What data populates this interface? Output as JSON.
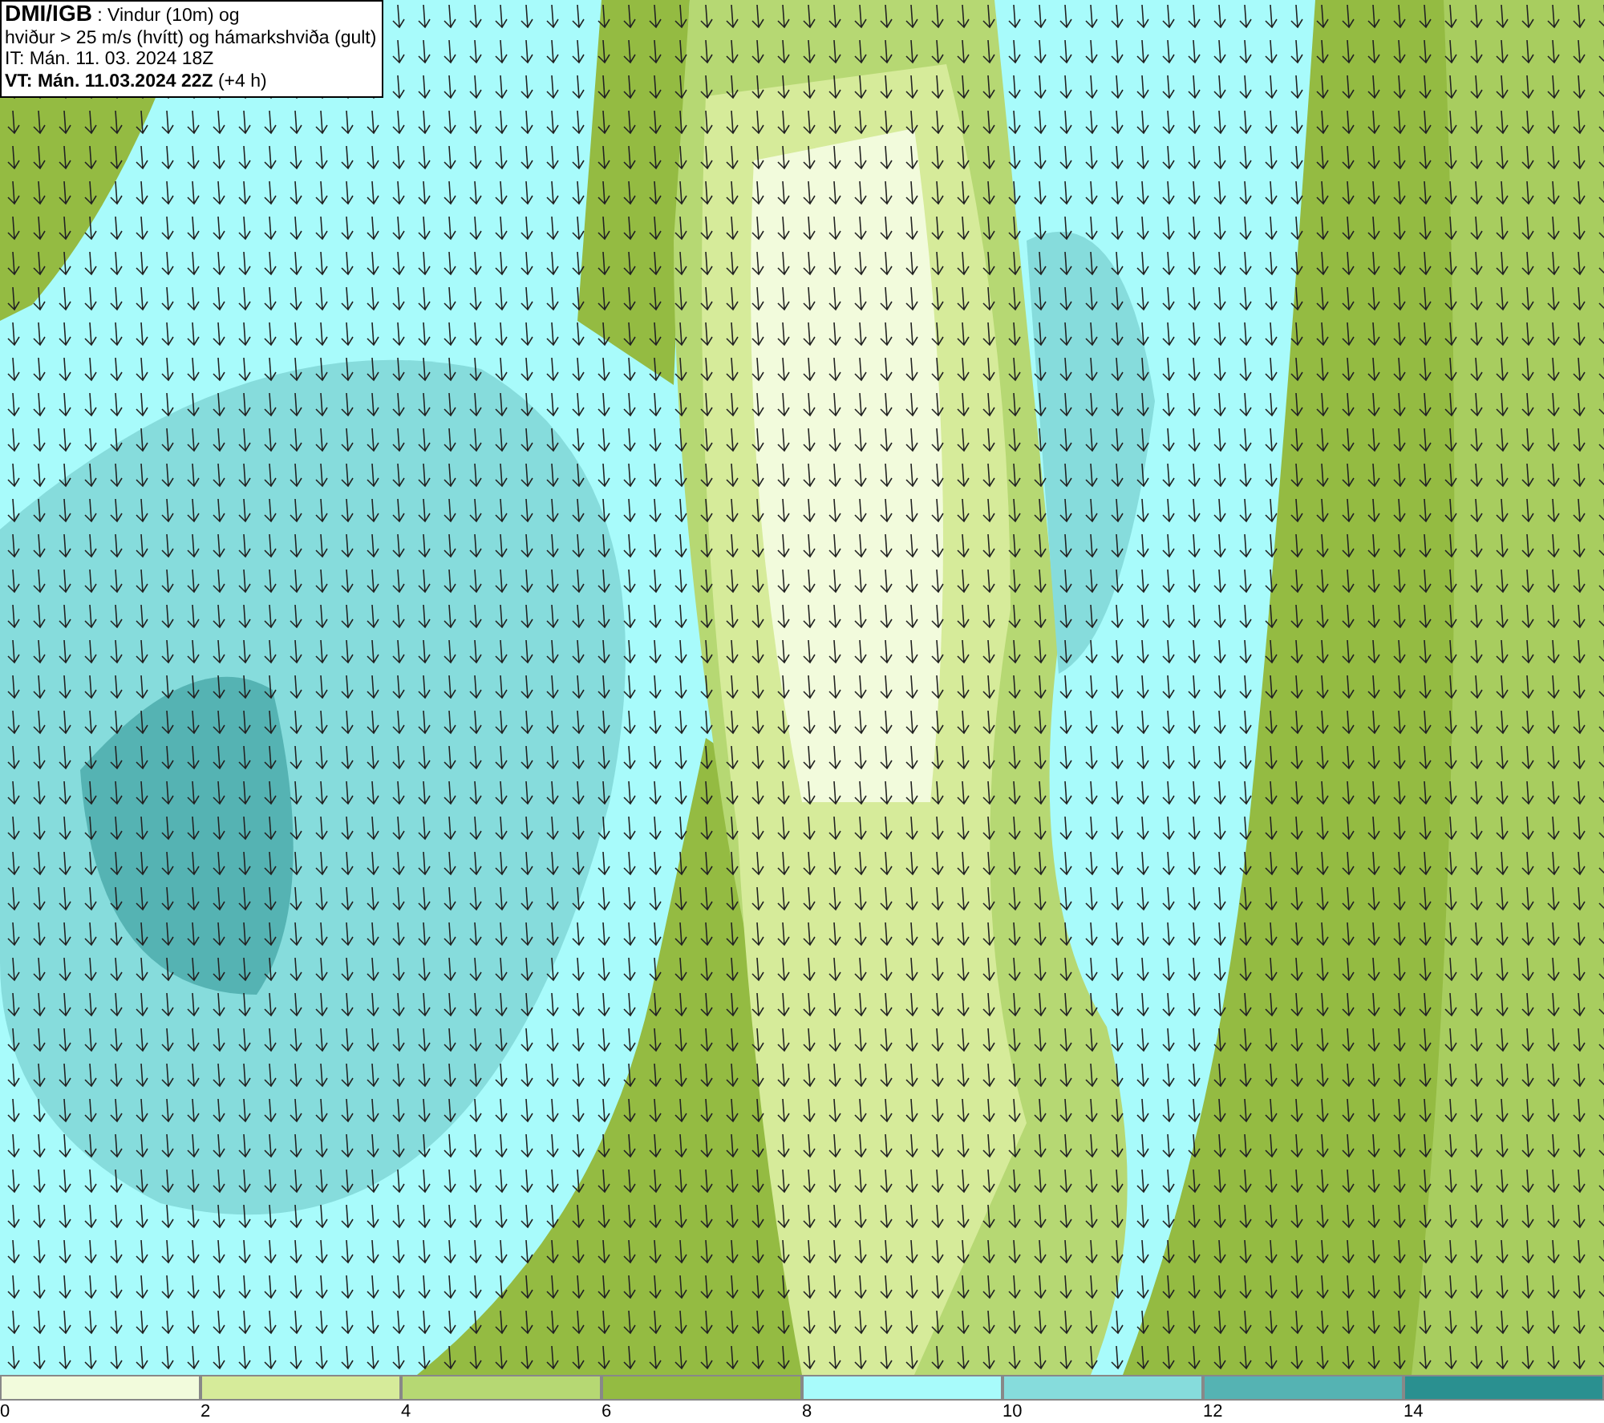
{
  "header": {
    "lines": [
      "**DMI/IGB** : Vindur (10m) og",
      "hviður > 25 m/s (hvítt) og hámarkshviða (gult)",
      "IT: Mán. 11. 03. 2024 18Z",
      "**VT: Mán. 11.03.2024 22Z** (+4 h)"
    ]
  },
  "legend": [
    {
      "label": "0",
      "color": "#f2fbdc"
    },
    {
      "label": "2",
      "color": "#d6eb9a"
    },
    {
      "label": "4",
      "color": "#b6d873"
    },
    {
      "label": "6",
      "color": "#94bb42"
    },
    {
      "label": "8",
      "color": "#a8fbfb"
    },
    {
      "label": "10",
      "color": "#86dcdc"
    },
    {
      "label": "12",
      "color": "#55b3b3"
    },
    {
      "label": "14",
      "color": "#2a9090"
    }
  ]
}
